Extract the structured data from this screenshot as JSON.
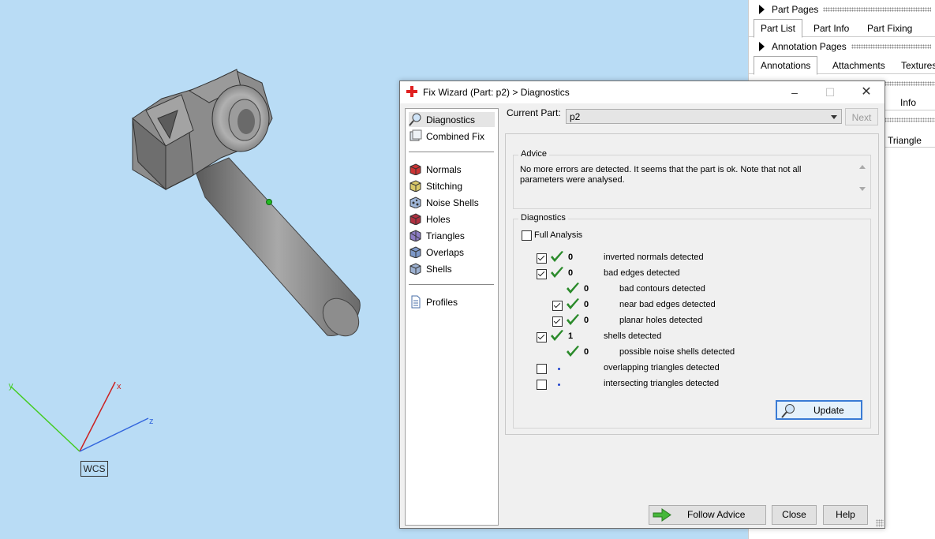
{
  "viewport": {
    "axes": {
      "x": "x",
      "y": "y",
      "z": "z"
    },
    "wcs_label": "WCS"
  },
  "right_panel": {
    "part_pages_title": "Part Pages",
    "part_tabs": [
      "Part List",
      "Part Info",
      "Part Fixing Info"
    ],
    "annotation_pages_title": "Annotation Pages",
    "annotation_tabs": [
      "Annotations",
      "Attachments",
      "Textures"
    ],
    "partial_info": "Info",
    "partial_triangle": "Triangle"
  },
  "dialog": {
    "title": "Fix Wizard (Part: p2) > Diagnostics",
    "nav": {
      "top": [
        "Diagnostics",
        "Combined Fix"
      ],
      "middle": [
        "Normals",
        "Stitching",
        "Noise Shells",
        "Holes",
        "Triangles",
        "Overlaps",
        "Shells"
      ],
      "bottom": [
        "Profiles"
      ]
    },
    "current_part_label": "Current Part:",
    "current_part_value": "p2",
    "next_label": "Next",
    "advice": {
      "title": "Advice",
      "text": "No more errors are detected. It seems that the part is ok. Note that not all parameters were analysed."
    },
    "diagnostics": {
      "title": "Diagnostics",
      "full_analysis": "Full Analysis",
      "full_analysis_checked": false,
      "rows": [
        {
          "checkbox": true,
          "checked": true,
          "status": "ok",
          "count": "0",
          "label": "inverted normals detected",
          "indent": 0
        },
        {
          "checkbox": true,
          "checked": true,
          "status": "ok",
          "count": "0",
          "label": "bad edges detected",
          "indent": 0
        },
        {
          "checkbox": false,
          "checked": false,
          "status": "ok",
          "count": "0",
          "label": "bad contours detected",
          "indent": 1
        },
        {
          "checkbox": true,
          "checked": true,
          "status": "ok",
          "count": "0",
          "label": "near bad edges detected",
          "indent": 1
        },
        {
          "checkbox": true,
          "checked": true,
          "status": "ok",
          "count": "0",
          "label": "planar holes detected",
          "indent": 1
        },
        {
          "checkbox": true,
          "checked": true,
          "status": "ok",
          "count": "1",
          "label": "shells detected",
          "indent": 0
        },
        {
          "checkbox": false,
          "checked": false,
          "status": "ok",
          "count": "0",
          "label": "possible noise shells detected",
          "indent": 1
        },
        {
          "checkbox": true,
          "checked": false,
          "status": "pending",
          "count": "",
          "label": "overlapping triangles detected",
          "indent": 0
        },
        {
          "checkbox": true,
          "checked": false,
          "status": "pending",
          "count": "",
          "label": "intersecting triangles detected",
          "indent": 0
        }
      ],
      "update_label": "Update"
    },
    "footer": {
      "follow_advice": "Follow Advice",
      "close": "Close",
      "help": "Help"
    },
    "colors": {
      "ok_tick": "#2a8a2a",
      "pending_dot": "#2244cc"
    }
  }
}
